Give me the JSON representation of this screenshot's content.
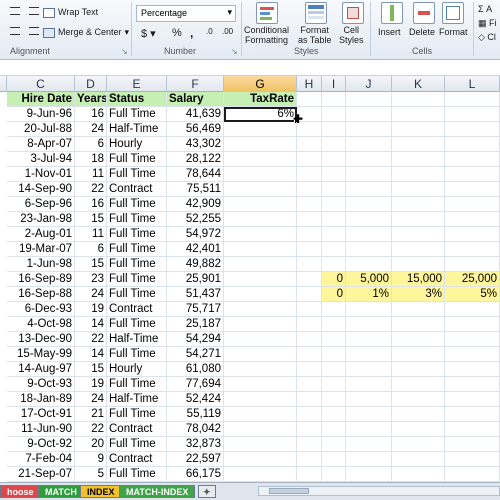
{
  "ribbon": {
    "wrap_text": "Wrap Text",
    "merge_center": "Merge & Center",
    "number_format": "Percentage",
    "currency": "$",
    "percent": "%",
    "comma": ",",
    "conditional_formatting": [
      "Conditional",
      "Formatting"
    ],
    "format_as_table": [
      "Format",
      "as Table"
    ],
    "cell_styles": [
      "Cell",
      "Styles"
    ],
    "insert": "Insert",
    "delete": "Delete",
    "format": "Format",
    "autosum_partial": "A",
    "fill_partial": "Fi",
    "clear_partial": "Cl",
    "groups": {
      "alignment": "Alignment",
      "number": "Number",
      "styles": "Styles",
      "cells": "Cells"
    }
  },
  "columns": [
    "C",
    "D",
    "E",
    "F",
    "G",
    "H",
    "I",
    "J",
    "K",
    "L"
  ],
  "selected_column": "G",
  "header_row": {
    "hire_date": "Hire Date",
    "years": "Years",
    "status": "Status",
    "salary": "Salary",
    "tax_rate": "TaxRate"
  },
  "active_cell_value": "6%",
  "rows": [
    [
      "9-Jun-96",
      "16",
      "Full Time",
      "41,639"
    ],
    [
      "20-Jul-88",
      "24",
      "Half-Time",
      "56,469"
    ],
    [
      "8-Apr-07",
      "6",
      "Hourly",
      "43,302"
    ],
    [
      "3-Jul-94",
      "18",
      "Full Time",
      "28,122"
    ],
    [
      "1-Nov-01",
      "11",
      "Full Time",
      "78,644"
    ],
    [
      "14-Sep-90",
      "22",
      "Contract",
      "75,511"
    ],
    [
      "6-Sep-96",
      "16",
      "Full Time",
      "42,909"
    ],
    [
      "23-Jan-98",
      "15",
      "Full Time",
      "52,255"
    ],
    [
      "2-Aug-01",
      "11",
      "Full Time",
      "54,972"
    ],
    [
      "19-Mar-07",
      "6",
      "Full Time",
      "42,401"
    ],
    [
      "1-Jun-98",
      "15",
      "Full Time",
      "49,882"
    ],
    [
      "16-Sep-89",
      "23",
      "Full Time",
      "25,901"
    ],
    [
      "16-Sep-88",
      "24",
      "Full Time",
      "51,437"
    ],
    [
      "6-Dec-93",
      "19",
      "Contract",
      "75,717"
    ],
    [
      "4-Oct-98",
      "14",
      "Full Time",
      "25,187"
    ],
    [
      "13-Dec-90",
      "22",
      "Half-Time",
      "54,294"
    ],
    [
      "15-May-99",
      "14",
      "Full Time",
      "54,271"
    ],
    [
      "14-Aug-97",
      "15",
      "Hourly",
      "61,080"
    ],
    [
      "9-Oct-93",
      "19",
      "Full Time",
      "77,694"
    ],
    [
      "18-Jan-89",
      "24",
      "Half-Time",
      "52,424"
    ],
    [
      "17-Oct-91",
      "21",
      "Full Time",
      "55,119"
    ],
    [
      "11-Jun-90",
      "22",
      "Contract",
      "78,042"
    ],
    [
      "9-Oct-92",
      "20",
      "Full Time",
      "32,873"
    ],
    [
      "7-Feb-04",
      "9",
      "Contract",
      "22,597"
    ],
    [
      "21-Sep-07",
      "5",
      "Full Time",
      "66,175"
    ]
  ],
  "lookup_table": {
    "thresholds": [
      "0",
      "5,000",
      "15,000",
      "25,000"
    ],
    "rates": [
      "0",
      "1%",
      "3%",
      "5%"
    ]
  },
  "sheet_tabs": [
    "hoose",
    "MATCH",
    "INDEX",
    "MATCH-INDEX"
  ],
  "colors": {
    "header_fill": "#c6efb3",
    "lookup_fill": "#fff59a",
    "selected_col": "#f1c15f"
  }
}
